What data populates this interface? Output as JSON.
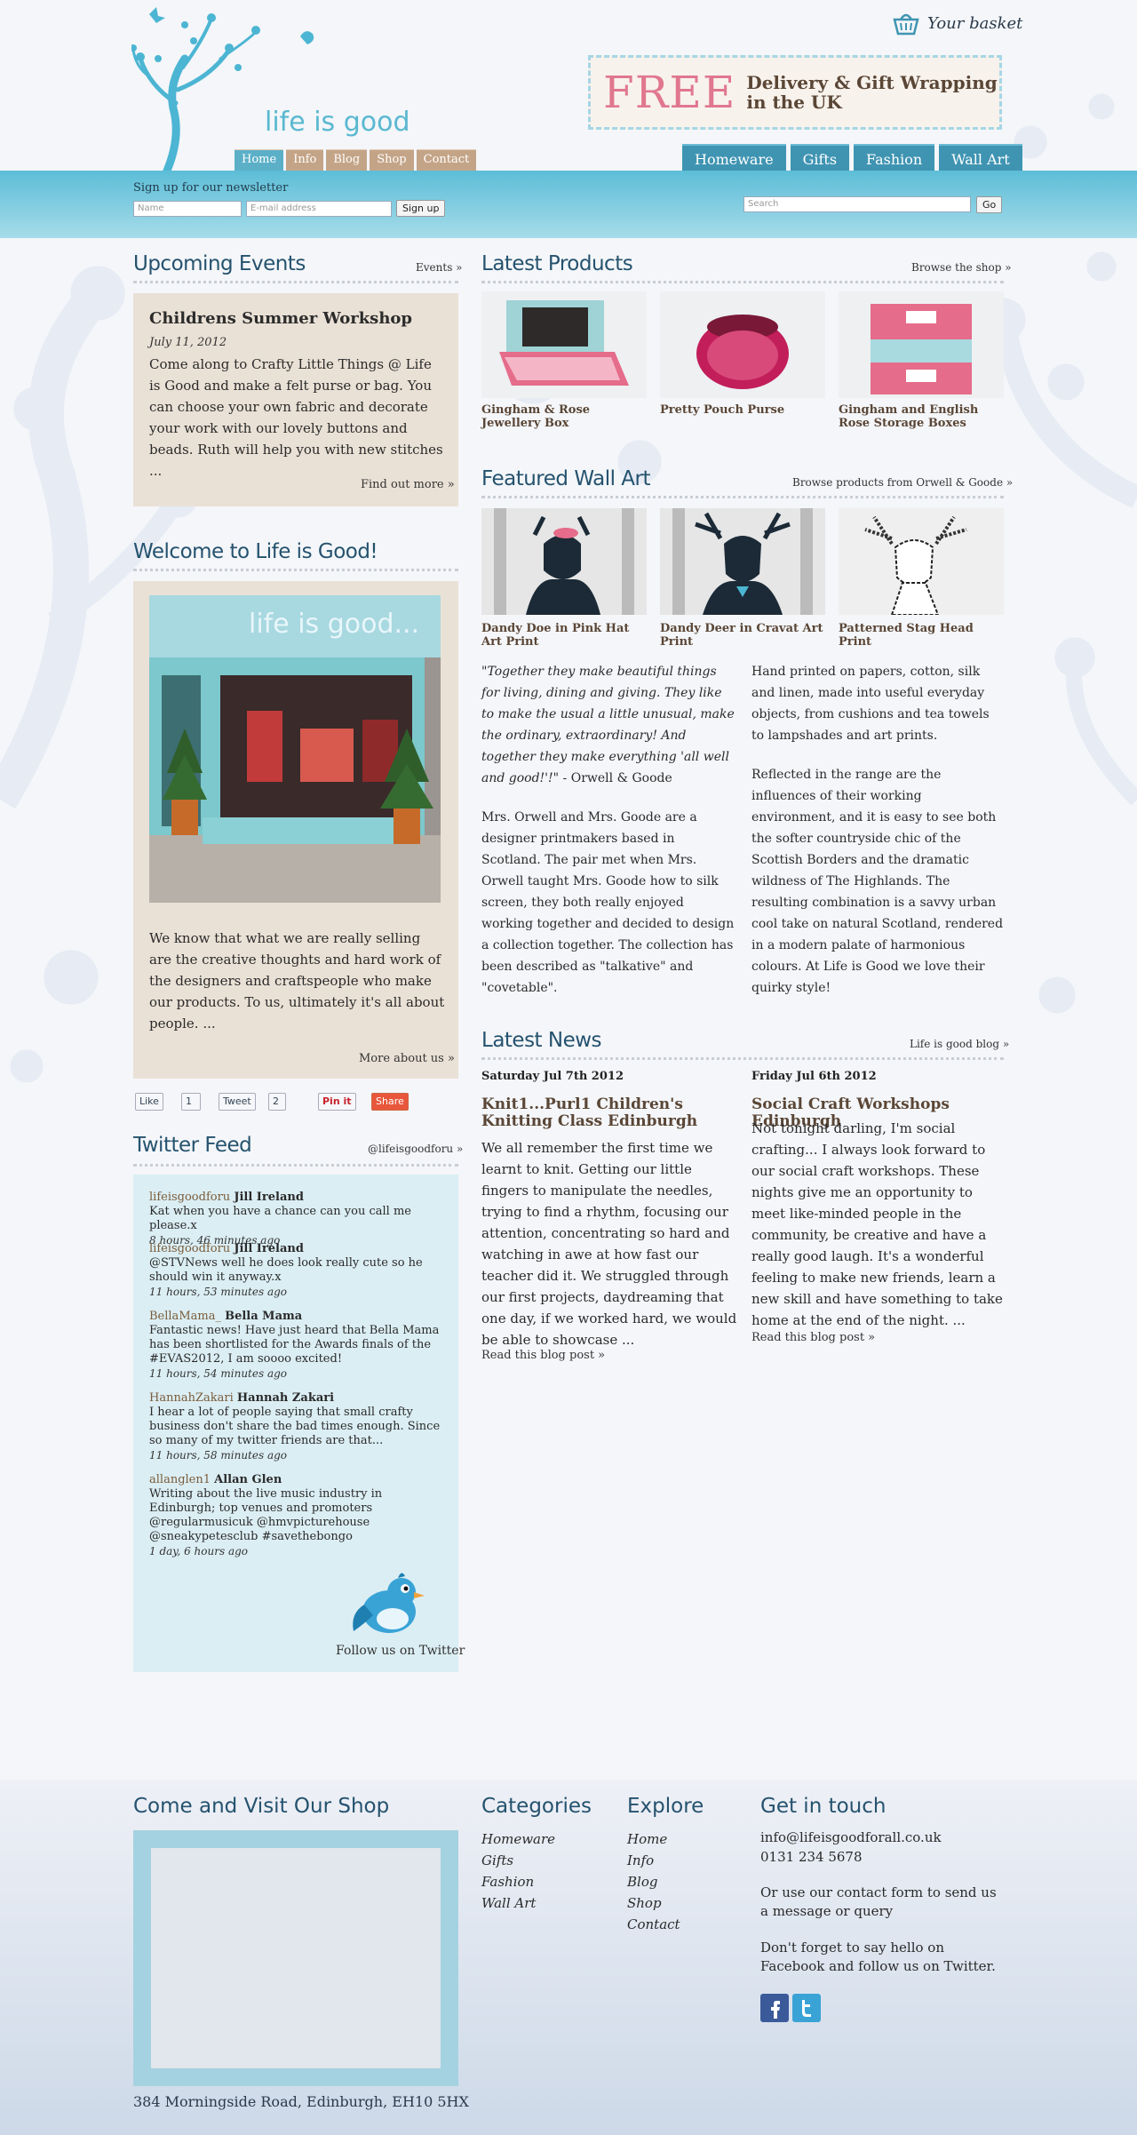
{
  "header": {
    "logo_text": "life is good",
    "basket_label": "Your basket",
    "banner_free": "FREE",
    "banner_text": "Delivery & Gift Wrapping in the UK",
    "small_nav": [
      "Home",
      "Info",
      "Blog",
      "Shop",
      "Contact"
    ],
    "big_nav": [
      "Homeware",
      "Gifts",
      "Fashion",
      "Wall Art"
    ]
  },
  "newsletter": {
    "label": "Sign up for our newsletter",
    "name_placeholder": "Name",
    "email_placeholder": "E-mail address",
    "button": "Sign up"
  },
  "search": {
    "placeholder": "Search",
    "button": "Go"
  },
  "events": {
    "heading": "Upcoming Events",
    "link": "Events »",
    "title": "Childrens Summer Workshop",
    "date": "July 11, 2012",
    "body": "Come along to Crafty Little Things @ Life is Good and make a felt purse or bag. You can choose your own fabric and decorate your work with our lovely buttons and beads. Ruth will help you with new stitches ...",
    "more": "Find out more »"
  },
  "welcome": {
    "heading": "Welcome to Life is Good!",
    "photo_sign": "life is good...",
    "body": "We know that what we are really selling are the creative thoughts and hard work of the designers and craftspeople who make our products. To us, ultimately it's all about people. ...",
    "more": "More about us »"
  },
  "social": {
    "like": "Like",
    "like_count": "1",
    "tweet": "Tweet",
    "tweet_count": "2",
    "pin": "Pin it",
    "share": "Share"
  },
  "twitter": {
    "heading": "Twitter Feed",
    "link": "@lifeisgoodforu »",
    "tweets": [
      {
        "handle": "lifeisgoodforu",
        "name": "Jill Ireland",
        "text": "Kat when you have a chance can you call me please.x",
        "time": "8 hours, 46 minutes ago"
      },
      {
        "handle": "lifeisgoodforu",
        "name": "Jill Ireland",
        "text": "@STVNews well he does look really cute so he should win it anyway.x",
        "time": "11 hours, 53 minutes ago"
      },
      {
        "handle": "BellaMama_",
        "name": "Bella Mama",
        "text": "Fantastic news! Have just heard that Bella Mama has been shortlisted for the Awards finals of the #EVAS2012, I am soooo excited!",
        "time": "11 hours, 54 minutes ago"
      },
      {
        "handle": "HannahZakari",
        "name": "Hannah Zakari",
        "text": "I hear a lot of people saying that small crafty business don't share the bad times enough. Since so many of my twitter friends are that...",
        "time": "11 hours, 58 minutes ago"
      },
      {
        "handle": "allanglen1",
        "name": "Allan Glen",
        "text": "Writing about the live music industry in Edinburgh; top venues and promoters @regularmusicuk @hmvpicturehouse @sneakypetesclub #savethebongo",
        "time": "1 day, 6 hours ago"
      }
    ],
    "follow": "Follow us on Twitter"
  },
  "latest_products": {
    "heading": "Latest Products",
    "link": "Browse the shop »",
    "items": [
      "Gingham & Rose Jewellery Box",
      "Pretty Pouch Purse",
      "Gingham and English Rose Storage Boxes"
    ]
  },
  "wall_art": {
    "heading": "Featured Wall Art",
    "link": "Browse products from Orwell & Goode »",
    "items": [
      "Dandy Doe in Pink Hat Art Print",
      "Dandy Deer in Cravat Art Print",
      "Patterned Stag Head Print"
    ],
    "quote": "\"Together they make beautiful things for living, dining and giving. They like to make the usual a little unusual, make the ordinary, extraordinary! And together they make everything 'all well and good!'!\"",
    "quote_attrib": " - Orwell & Goode",
    "para1": "Mrs. Orwell and Mrs. Goode are a designer printmakers based in Scotland. The pair met when Mrs. Orwell taught Mrs. Goode how to silk screen, they both really enjoyed working together and decided to design a collection together. The collection has been described as \"talkative\" and \"covetable\".",
    "para2": "Hand printed on papers, cotton, silk and linen, made into useful everyday objects, from cushions and tea towels to lampshades and art prints.",
    "para3": "Reflected in the range are the influences of their working environment, and it is easy to see both the softer countryside chic of the Scottish Borders and the dramatic wildness of The Highlands. The resulting combination is a savvy urban cool take on natural Scotland, rendered in a modern palate of harmonious colours. At Life is Good we love their quirky style!"
  },
  "news": {
    "heading": "Latest News",
    "link": "Life is good blog »",
    "posts": [
      {
        "date": "Saturday Jul 7th 2012",
        "title": "Knit1...Purl1 Children's Knitting Class Edinburgh",
        "body": "We all remember the first time we learnt to knit. Getting our little fingers to manipulate the needles, trying to find a rhythm, focusing our attention, concentrating so hard and watching in awe at how fast our teacher did it. We struggled through our first projects, daydreaming that one day, if we worked hard, we would be able to showcase ...",
        "more": "Read this blog post »"
      },
      {
        "date": "Friday Jul 6th 2012",
        "title": "Social Craft Workshops Edinburgh",
        "body": "Not tonight darling, I'm social crafting... I always look forward to our social craft workshops. These nights give me an opportunity to meet like-minded people in the community, be creative and have a really good laugh. It's a wonderful feeling to make new friends, learn a new skill and have something to take home at the end of the night. ...",
        "more": "Read this blog post »"
      }
    ]
  },
  "footer": {
    "visit_heading": "Come and Visit Our Shop",
    "address": "384 Morningside Road, Edinburgh, EH10 5HX",
    "categories_heading": "Categories",
    "categories": [
      "Homeware",
      "Gifts",
      "Fashion",
      "Wall Art"
    ],
    "explore_heading": "Explore",
    "explore": [
      "Home",
      "Info",
      "Blog",
      "Shop",
      "Contact"
    ],
    "contact_heading": "Get in touch",
    "email": "info@lifeisgoodforall.co.uk",
    "phone": "0131 234 5678",
    "contact_text": "Or use our contact form to send us a message or query",
    "social_text": "Don't forget to say hello on Facebook and follow us on Twitter."
  },
  "colors": {
    "accent_blue": "#3f94b2",
    "heading_blue": "#25526e",
    "tan": "#c4a487",
    "pink": "#e0778f"
  }
}
